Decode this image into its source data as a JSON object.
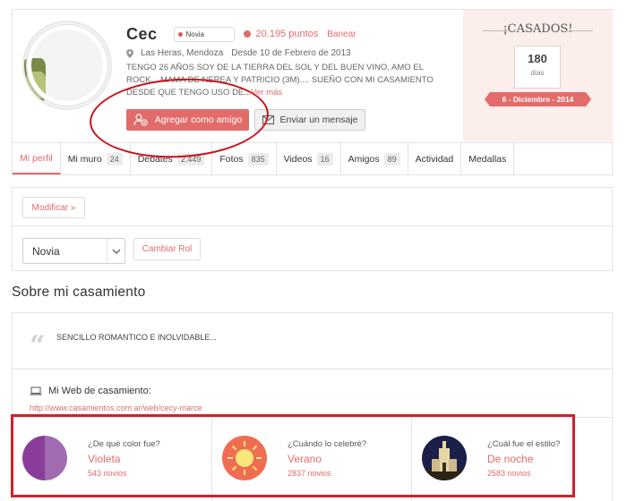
{
  "profile": {
    "name": "Cec",
    "role_badge": "Novia",
    "points": "20.195 puntos",
    "ban_label": "Banear",
    "location": "Las Heras, Mendoza",
    "member_since": "Desde 10 de Febrero de 2013",
    "bio": "TENGO 26 AÑOS SOY DE LA TIERRA DEL SOL Y DEL BUEN VINO, AMO EL ROCK... MAMA DE NEREA Y PATRICIO (3M).... SUEÑO CON MI CASAMIENTO DESDE QUE TENGO USO DE...",
    "bio_more": "Ver más",
    "add_friend_label": "Agregar como amigo",
    "send_message_label": "Enviar un mensaje"
  },
  "married": {
    "title": "¡CASADOS!",
    "days_count": "180",
    "days_label": "días",
    "date": "6 - Diciembre - 2014"
  },
  "tabs": [
    {
      "label": "Mi perfil",
      "count": ""
    },
    {
      "label": "Mi muro",
      "count": "24"
    },
    {
      "label": "Debates",
      "count": "2.449"
    },
    {
      "label": "Fotos",
      "count": "835"
    },
    {
      "label": "Videos",
      "count": "16"
    },
    {
      "label": "Amigos",
      "count": "89"
    },
    {
      "label": "Actividad",
      "count": ""
    },
    {
      "label": "Medallas",
      "count": ""
    }
  ],
  "controls": {
    "modify_label": "Modificar »",
    "role_select_value": "Novia",
    "change_role_label": "Cambiar Rol"
  },
  "section": {
    "title": "Sobre mi casamiento",
    "quote": "SENCILLO ROMANTICO E INOLVIDABLE...",
    "web_label": "Mi Web de casamiento:",
    "web_url": "http://www.casamientos.com.ar/web/cecy-marce"
  },
  "facts": [
    {
      "question": "¿De qué color fue?",
      "answer": "Violeta",
      "count": "543 novios",
      "icon": "color-violet-icon"
    },
    {
      "question": "¿Cuándo lo celebré?",
      "answer": "Verano",
      "count": "2837 novios",
      "icon": "sun-icon"
    },
    {
      "question": "¿Cuál fue el estilo?",
      "answer": "De noche",
      "count": "2583 novios",
      "icon": "night-church-icon"
    }
  ],
  "colors": {
    "accent": "#e26c6a",
    "annotation_red": "#d0202a",
    "married_bg": "#fbeeeb"
  }
}
